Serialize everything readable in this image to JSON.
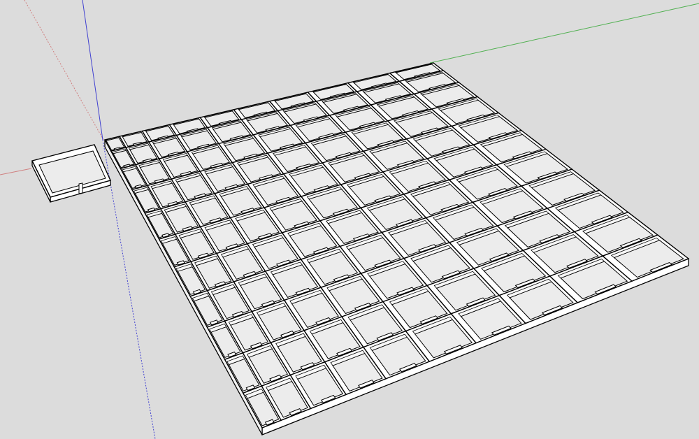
{
  "app": {
    "type": "3d-modeling-viewport",
    "background_color": "#dcdcdc"
  },
  "axes": {
    "red": {
      "color": "#d08080",
      "style": "dotted-and-solid"
    },
    "green": {
      "color": "#50b050",
      "style": "solid"
    },
    "blue": {
      "color": "#4040d0",
      "style": "solid-and-dotted"
    }
  },
  "model": {
    "tray_grid": {
      "rows": 11,
      "cols": 10,
      "tray_fill": "#ececec",
      "edge_color": "#000000",
      "has_label_slots": true
    },
    "single_tray": {
      "fill": "#ececec",
      "edge_color": "#000000"
    }
  }
}
